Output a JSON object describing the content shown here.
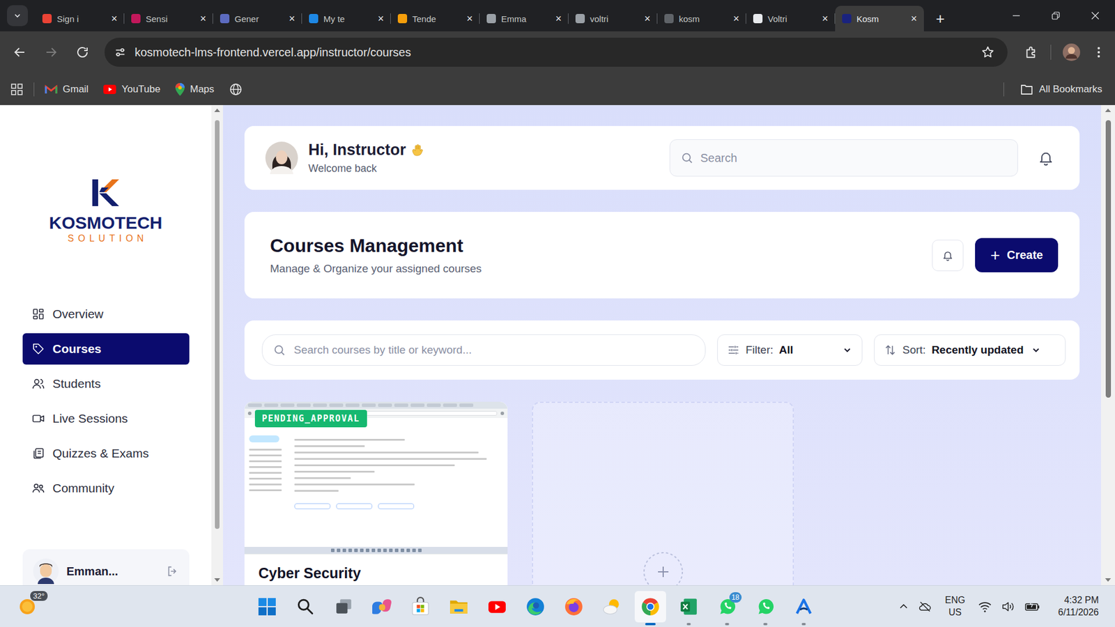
{
  "browser": {
    "tabs": [
      {
        "label": "Sign i",
        "selected": false,
        "color": "#ea4335"
      },
      {
        "label": "Sensi",
        "selected": false,
        "color": "#c2185b"
      },
      {
        "label": "Gener",
        "selected": false,
        "color": "#5c6bc0"
      },
      {
        "label": "My te",
        "selected": false,
        "color": "#1e88e5"
      },
      {
        "label": "Tende",
        "selected": false,
        "color": "#f59e0b"
      },
      {
        "label": "Emma",
        "selected": false,
        "color": "#9aa0a6"
      },
      {
        "label": "voltri",
        "selected": false,
        "color": "#9aa0a6"
      },
      {
        "label": "kosm",
        "selected": false,
        "color": "#5f6368"
      },
      {
        "label": "Voltri",
        "selected": false,
        "color": "#e8eaed"
      },
      {
        "label": "Kosm",
        "selected": true,
        "color": "#1a237e"
      }
    ],
    "close_glyph": "×",
    "new_tab": "+",
    "nav": [
      {
        "kind": "back",
        "disabled": false
      },
      {
        "kind": "forward",
        "disabled": true
      },
      {
        "kind": "reload",
        "disabled": false
      }
    ],
    "address": "kosmotech-lms-frontend.vercel.app/instructor/courses",
    "bookmarks": [
      {
        "kind": "gmail",
        "label": "Gmail"
      },
      {
        "kind": "youtube",
        "label": "YouTube"
      },
      {
        "kind": "maps",
        "label": "Maps"
      },
      {
        "kind": "globe",
        "label": ""
      }
    ],
    "all_bookmarks": "All Bookmarks"
  },
  "sidebar": {
    "logo": {
      "name": "KOSMOTECH",
      "tagline": "SOLUTION"
    },
    "items": [
      {
        "kind": "overview",
        "label": "Overview",
        "selected": false
      },
      {
        "kind": "courses",
        "label": "Courses",
        "selected": true
      },
      {
        "kind": "students",
        "label": "Students",
        "selected": false
      },
      {
        "kind": "live",
        "label": "Live Sessions",
        "selected": false
      },
      {
        "kind": "quizzes",
        "label": "Quizzes & Exams",
        "selected": false
      },
      {
        "kind": "community",
        "label": "Community",
        "selected": false
      }
    ],
    "user": {
      "name": "Emman..."
    }
  },
  "header": {
    "greeting": "Hi, Instructor",
    "subtitle": "Welcome back",
    "search_placeholder": "Search"
  },
  "page": {
    "title": "Courses Management",
    "subtitle": "Manage & Organize your assigned courses",
    "create_icon": "+",
    "create_label": "Create"
  },
  "filters": {
    "search_placeholder": "Search courses by title or keyword...",
    "filter_label": "Filter:",
    "filter_value": "All",
    "sort_label": "Sort:",
    "sort_value": "Recently updated"
  },
  "courses": [
    {
      "title": "Cyber Security",
      "status": "PENDING_APPROVAL"
    }
  ],
  "taskbar": {
    "weather": {
      "temp": "32°"
    },
    "apps": [
      {
        "kind": "start",
        "running": false,
        "selected": false
      },
      {
        "kind": "search",
        "running": false,
        "selected": false
      },
      {
        "kind": "taskview",
        "running": false,
        "selected": false
      },
      {
        "kind": "copilot",
        "running": false,
        "selected": false
      },
      {
        "kind": "store",
        "running": false,
        "selected": false
      },
      {
        "kind": "explorer",
        "running": false,
        "selected": false
      },
      {
        "kind": "youtube",
        "running": false,
        "selected": false
      },
      {
        "kind": "edge",
        "running": false,
        "selected": false
      },
      {
        "kind": "firefox",
        "running": false,
        "selected": false
      },
      {
        "kind": "weather",
        "running": false,
        "selected": false
      },
      {
        "kind": "chrome",
        "running": true,
        "selected": true
      },
      {
        "kind": "excel",
        "running": true,
        "selected": false
      },
      {
        "kind": "whatsapp",
        "running": true,
        "selected": false,
        "badge": "18"
      },
      {
        "kind": "whatsapp",
        "running": true,
        "selected": false
      },
      {
        "kind": "arc",
        "running": true,
        "selected": false
      }
    ],
    "tray": {
      "lang": "ENG",
      "region": "US",
      "time": "4:32 PM",
      "date": "6/11/2026"
    }
  }
}
